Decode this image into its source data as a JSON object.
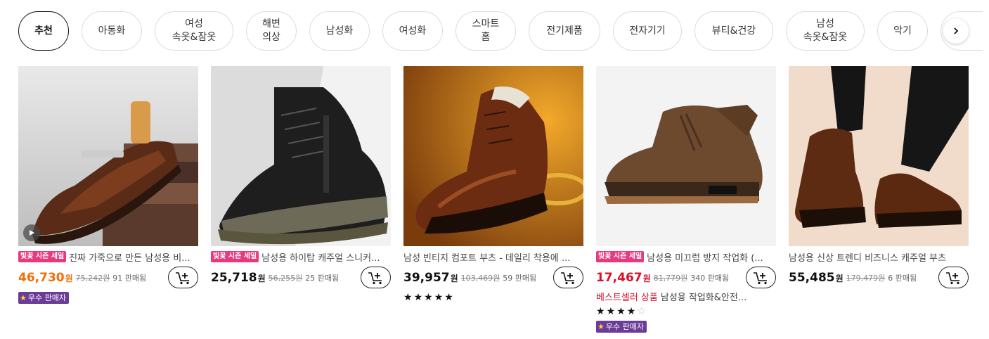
{
  "categories": [
    {
      "label": "추천",
      "active": true
    },
    {
      "label": "아동화"
    },
    {
      "label": "여성\n속옷&잠옷"
    },
    {
      "label": "해변\n의상"
    },
    {
      "label": "남성화"
    },
    {
      "label": "여성화"
    },
    {
      "label": "스마트\n홈"
    },
    {
      "label": "전기제품"
    },
    {
      "label": "전자기기"
    },
    {
      "label": "뷰티&건강"
    },
    {
      "label": "남성\n속옷&잠옷"
    },
    {
      "label": "악기"
    }
  ],
  "next_icon": "chevron-right-icon",
  "products": [
    {
      "badge": "빛꽃 시즌 세일",
      "title": "진짜 가죽으로 만든 남성용 비...",
      "price": "46,730",
      "currency": "원",
      "original_price": "75,242원",
      "sold": "91 판매됨",
      "price_color": "#f26d06",
      "seller_badge": "우수 판매자",
      "has_video": true
    },
    {
      "badge": "빛꽃 시즌 세일",
      "title": "남성용 하이탑 캐주얼 스니커...",
      "price": "25,718",
      "currency": "원",
      "original_price": "56,255원",
      "sold": "25 판매됨"
    },
    {
      "title": "남성 빈티지 컴포트 부츠 - 데일리 착용에 ...",
      "price": "39,957",
      "currency": "원",
      "original_price": "103,469원",
      "sold": "59 판매됨",
      "rating": 5
    },
    {
      "badge": "빛꽃 시즌 세일",
      "title": "남성용 미끄럼 방지 작업화 (...",
      "price": "17,467",
      "currency": "원",
      "original_price": "81,779원",
      "sold": "340 판매됨",
      "price_color": "#d8102c",
      "best_label": "베스트셀러 상품",
      "best_text": "남성용 작업화&안전...",
      "rating": 4.5,
      "seller_badge": "우수 판매자"
    },
    {
      "title": "남성용 신상 트렌디 비즈니스 캐주얼 부츠",
      "price": "55,485",
      "currency": "원",
      "original_price": "179,479원",
      "sold": "6 판매됨"
    }
  ],
  "colors": {
    "sale_badge": "#e8397e",
    "seller_badge": "#6a3c97",
    "price_orange": "#f26d06",
    "price_red": "#d8102c"
  }
}
